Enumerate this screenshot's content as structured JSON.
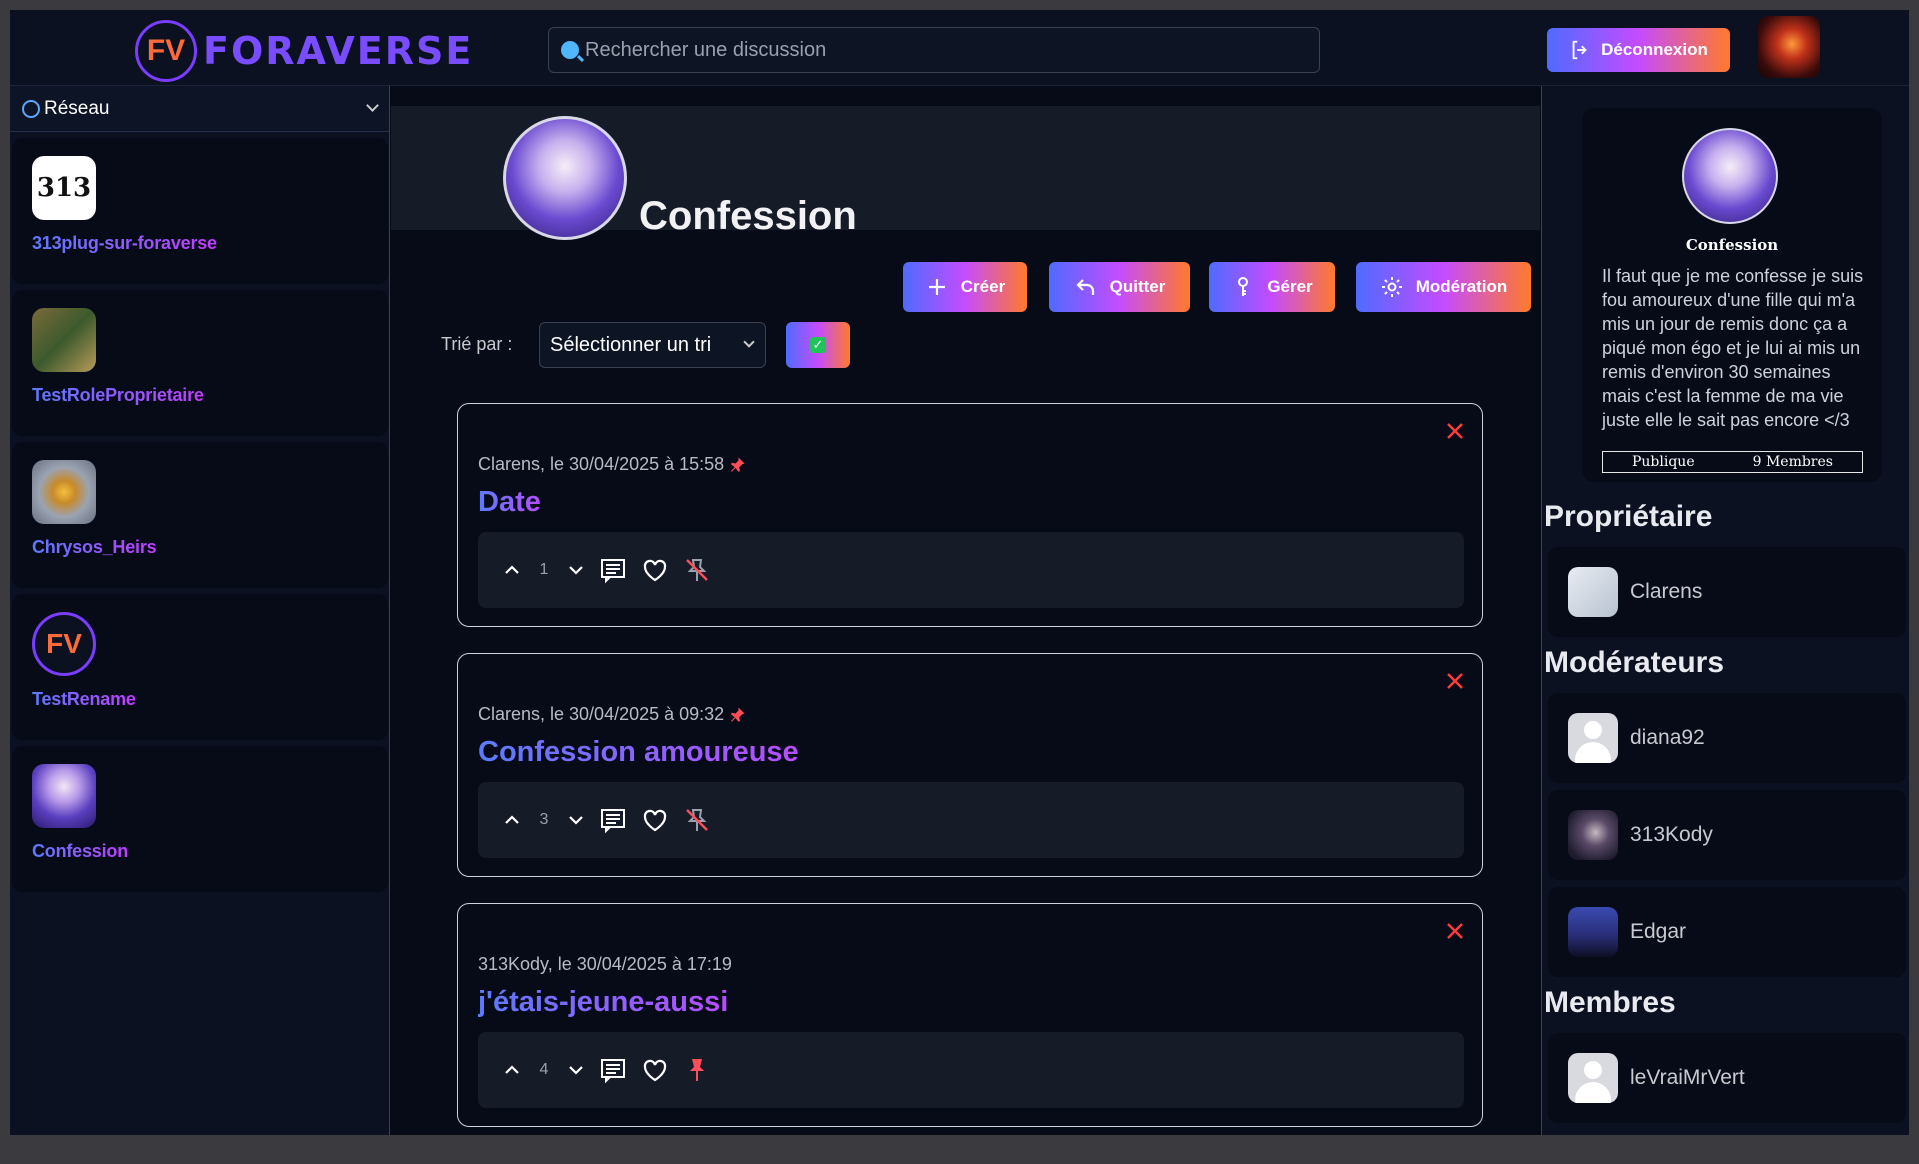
{
  "header": {
    "logo_badge": "FV",
    "logo_text": "FORAVERSE",
    "search_placeholder": "Rechercher une discussion",
    "logout_label": "Déconnexion"
  },
  "sidebar": {
    "network_label": "Réseau",
    "communities": [
      {
        "name": "313plug-sur-foraverse",
        "avatar_text": "313"
      },
      {
        "name": "TestRoleProprietaire"
      },
      {
        "name": "Chrysos_Heirs"
      },
      {
        "name": "TestRename",
        "avatar_text": "FV"
      },
      {
        "name": "Confession"
      }
    ]
  },
  "community": {
    "title": "Confession",
    "buttons": {
      "create": "Créer",
      "leave": "Quitter",
      "manage": "Gérer",
      "moderation": "Modération"
    },
    "sort_label": "Trié par :",
    "sort_value": "Sélectionner un tri"
  },
  "posts": [
    {
      "meta": "Clarens, le 30/04/2025 à 15:58",
      "pinned": true,
      "title": "Date",
      "votes": "1"
    },
    {
      "meta": "Clarens, le 30/04/2025 à 09:32",
      "pinned": true,
      "title": "Confession amoureuse",
      "votes": "3"
    },
    {
      "meta": "313Kody, le 30/04/2025 à 17:19",
      "pinned": false,
      "title": "j'étais-jeune-aussi",
      "votes": "4"
    }
  ],
  "info": {
    "name": "Confession",
    "description": "Il faut que je me confesse je suis fou amoureux d'une fille qui m'a mis un jour de remis donc ça a piqué mon égo et je lui ai mis un remis d'environ 30 semaines mais c'est la femme de ma vie juste elle le sait pas encore </3",
    "visibility": "Publique",
    "members_count": "9 Membres"
  },
  "roles": {
    "owner_title": "Propriétaire",
    "owner": "Clarens",
    "moderators_title": "Modérateurs",
    "moderators": [
      "diana92",
      "313Kody",
      "Edgar"
    ],
    "members_title": "Membres",
    "members": [
      "leVraiMrVert"
    ]
  },
  "colors": {
    "accent_start": "#4f6bff",
    "accent_mid": "#c44cff",
    "accent_end": "#ff7a2a",
    "background": "#070b17",
    "panel": "#0b1120",
    "close_red": "#ff3b3b",
    "pin_red": "#ff4d5a"
  }
}
